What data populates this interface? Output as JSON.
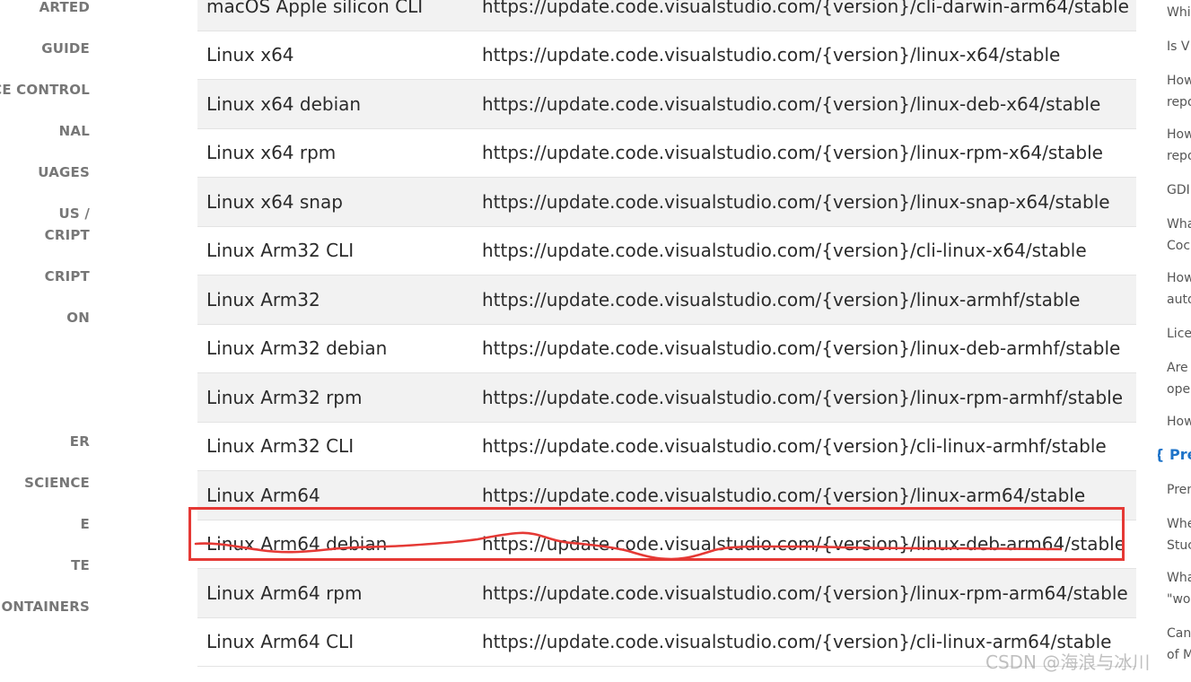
{
  "left_nav": {
    "items": [
      {
        "lines": [
          "ARTED"
        ]
      },
      {
        "lines": [
          "GUIDE"
        ]
      },
      {
        "lines": [
          "CE CONTROL"
        ]
      },
      {
        "lines": [
          "NAL"
        ]
      },
      {
        "lines": [
          "UAGES"
        ]
      },
      {
        "lines": [
          "US /",
          "CRIPT"
        ]
      },
      {
        "lines": [
          "CRIPT"
        ]
      },
      {
        "lines": [
          "ON"
        ]
      },
      {
        "lines": [
          "ER"
        ]
      },
      {
        "lines": [
          "SCIENCE"
        ]
      },
      {
        "lines": [
          "E"
        ]
      },
      {
        "lines": [
          "TE"
        ]
      },
      {
        "lines": [
          "ONTAINERS"
        ]
      }
    ]
  },
  "table": {
    "rows": [
      {
        "platform": "macOS Apple silicon CLI",
        "url": "https://update.code.visualstudio.com/{version}/cli-darwin-arm64/stable"
      },
      {
        "platform": "Linux x64",
        "url": "https://update.code.visualstudio.com/{version}/linux-x64/stable"
      },
      {
        "platform": "Linux x64 debian",
        "url": "https://update.code.visualstudio.com/{version}/linux-deb-x64/stable"
      },
      {
        "platform": "Linux x64 rpm",
        "url": "https://update.code.visualstudio.com/{version}/linux-rpm-x64/stable"
      },
      {
        "platform": "Linux x64 snap",
        "url": "https://update.code.visualstudio.com/{version}/linux-snap-x64/stable"
      },
      {
        "platform": "Linux Arm32 CLI",
        "url": "https://update.code.visualstudio.com/{version}/cli-linux-x64/stable"
      },
      {
        "platform": "Linux Arm32",
        "url": "https://update.code.visualstudio.com/{version}/linux-armhf/stable"
      },
      {
        "platform": "Linux Arm32 debian",
        "url": "https://update.code.visualstudio.com/{version}/linux-deb-armhf/stable"
      },
      {
        "platform": "Linux Arm32 rpm",
        "url": "https://update.code.visualstudio.com/{version}/linux-rpm-armhf/stable"
      },
      {
        "platform": "Linux Arm32 CLI",
        "url": "https://update.code.visualstudio.com/{version}/cli-linux-armhf/stable"
      },
      {
        "platform": "Linux Arm64",
        "url": "https://update.code.visualstudio.com/{version}/linux-arm64/stable"
      },
      {
        "platform": "Linux Arm64 debian",
        "url": "https://update.code.visualstudio.com/{version}/linux-deb-arm64/stable"
      },
      {
        "platform": "Linux Arm64 rpm",
        "url": "https://update.code.visualstudio.com/{version}/linux-rpm-arm64/stable"
      },
      {
        "platform": "Linux Arm64 CLI",
        "url": "https://update.code.visualstudio.com/{version}/cli-linux-arm64/stable"
      }
    ],
    "highlighted_row": 11
  },
  "annotation": {
    "color": "#e53935"
  },
  "right_toc": {
    "items": [
      {
        "lines": [
          "Whi"
        ]
      },
      {
        "lines": [
          "Is V"
        ]
      },
      {
        "lines": [
          "How",
          "repo"
        ]
      },
      {
        "lines": [
          "How",
          "repo"
        ]
      },
      {
        "lines": [
          "GDI"
        ]
      },
      {
        "lines": [
          "Wha",
          "Coc"
        ]
      },
      {
        "lines": [
          "How",
          "auto"
        ]
      },
      {
        "lines": [
          "Lice"
        ]
      },
      {
        "lines": [
          "Are",
          "ope"
        ]
      },
      {
        "lines": [
          "How"
        ]
      },
      {
        "lines": [
          "Pren"
        ]
      },
      {
        "lines": [
          "Whe",
          "Stuc"
        ]
      },
      {
        "lines": [
          "Wha",
          "\"wo"
        ]
      },
      {
        "lines": [
          "Can",
          "of M"
        ]
      }
    ],
    "section_heading": "{ Pre",
    "accent": "#1e73c8"
  },
  "watermark": "CSDN @海浪与冰川"
}
